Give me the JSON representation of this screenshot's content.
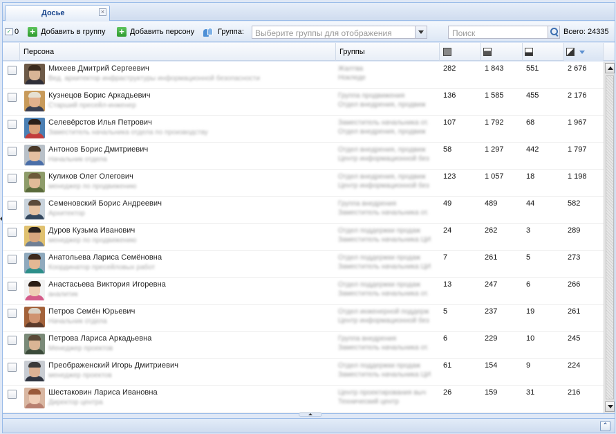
{
  "tab": {
    "title": "Досье",
    "close_glyph": "×"
  },
  "toolbar": {
    "selected_count": "0",
    "add_to_group": "Добавить в группу",
    "add_person": "Добавить персону",
    "group_label": "Группа:",
    "group_placeholder": "Выберите группы для отображения",
    "search_placeholder": "Поиск",
    "total": "Всего: 24335"
  },
  "columns": {
    "person": "Персона",
    "groups": "Группы",
    "metric_icons": [
      "metric-1-icon",
      "metric-2-icon",
      "metric-3-icon",
      "metric-4-icon"
    ],
    "sorted_by": "metric-4",
    "sort_direction": "desc"
  },
  "rows": [
    {
      "name": "Михеев Дмитрий Сергеевич",
      "role": "Вед. архитектор инфраструктуры информационной безопасности",
      "groups": [
        "Жалтва",
        "Нокледе"
      ],
      "m1": "282",
      "m2": "1 843",
      "m3": "551",
      "m4": "2 676"
    },
    {
      "name": "Кузнецов Борис Аркадьевич",
      "role": "Старший пресейл-инженер",
      "groups": [
        "Группа продвижения",
        "Отдел внедрения, продвиж"
      ],
      "m1": "136",
      "m2": "1 585",
      "m3": "455",
      "m4": "2 176"
    },
    {
      "name": "Селевёрстов Илья Петрович",
      "role": "Заместитель начальника отдела по производству",
      "groups": [
        "Заместитель начальника от.",
        "Отдел внедрения, продвиж"
      ],
      "m1": "107",
      "m2": "1 792",
      "m3": "68",
      "m4": "1 967"
    },
    {
      "name": "Антонов Борис Дмитриевич",
      "role": "Начальник отдела",
      "groups": [
        "Отдел внедрения, продвиж",
        "Центр информационной без"
      ],
      "m1": "58",
      "m2": "1 297",
      "m3": "442",
      "m4": "1 797"
    },
    {
      "name": "Куликов Олег Олегович",
      "role": "менеджер по продвижению",
      "groups": [
        "Отдел внедрения, продвиж",
        "Центр информационной без"
      ],
      "m1": "123",
      "m2": "1 057",
      "m3": "18",
      "m4": "1 198"
    },
    {
      "name": "Семеновский Борис Андреевич",
      "role": "Архитектор",
      "groups": [
        "Группа внедрения",
        "Заместитель начальника от."
      ],
      "m1": "49",
      "m2": "489",
      "m3": "44",
      "m4": "582"
    },
    {
      "name": "Дуров Кузьма Иванович",
      "role": "менеджер по продвижению",
      "groups": [
        "Отдел поддержки продаж",
        "Заместитель начальника ЦИ"
      ],
      "m1": "24",
      "m2": "262",
      "m3": "3",
      "m4": "289"
    },
    {
      "name": "Анатольева Лариса Семёновна",
      "role": "Координатор пресейловых работ",
      "groups": [
        "Отдел поддержки продаж",
        "Заместитель начальника ЦИ"
      ],
      "m1": "7",
      "m2": "261",
      "m3": "5",
      "m4": "273"
    },
    {
      "name": "Анастасьева Виктория Игоревна",
      "role": "аналитик",
      "groups": [
        "Отдел поддержки продаж",
        "Заместитель начальника от."
      ],
      "m1": "13",
      "m2": "247",
      "m3": "6",
      "m4": "266"
    },
    {
      "name": "Петров Семён Юрьевич",
      "role": "Начальник отдела",
      "groups": [
        "Отдел инженерной поддерж",
        "Центр информационной без"
      ],
      "m1": "5",
      "m2": "237",
      "m3": "19",
      "m4": "261"
    },
    {
      "name": "Петрова Лариса Аркадьевна",
      "role": "Менеджер проектов",
      "groups": [
        "Группа внедрения",
        "Заместитель начальника от."
      ],
      "m1": "6",
      "m2": "229",
      "m3": "10",
      "m4": "245"
    },
    {
      "name": "Преображенский Игорь Дмитриевич",
      "role": "менеджер проектов",
      "groups": [
        "Отдел поддержки продаж",
        "Заместитель начальника ЦИ"
      ],
      "m1": "61",
      "m2": "154",
      "m3": "9",
      "m4": "224"
    },
    {
      "name": "Шестаковин Лариса Ивановна",
      "role": "Директор центра",
      "groups": [
        "Центр проектирования выч",
        "Технический центр"
      ],
      "m1": "26",
      "m2": "159",
      "m3": "31",
      "m4": "216"
    }
  ],
  "avatar_palette": [
    {
      "bg": "#6d5a47",
      "hair": "#3a2a1c",
      "face": "#d8b596",
      "shoulders": "#2f2f38"
    },
    {
      "bg": "#c89a5a",
      "hair": "#e6e0d2",
      "face": "#e2b08c",
      "shoulders": "#3a3f52"
    },
    {
      "bg": "#4b7fb3",
      "hair": "#2b1f18",
      "face": "#d9a17a",
      "shoulders": "#c23d3d"
    },
    {
      "bg": "#b8c0c8",
      "hair": "#4a3a2a",
      "face": "#e4bfa1",
      "shoulders": "#4a6ea8"
    },
    {
      "bg": "#8e9c6a",
      "hair": "#6d5a3a",
      "face": "#e0bb98",
      "shoulders": "#596a3a"
    },
    {
      "bg": "#c9d3dc",
      "hair": "#5a4a3a",
      "face": "#e6c3a3",
      "shoulders": "#33475e"
    },
    {
      "bg": "#e0c170",
      "hair": "#2a2220",
      "face": "#d7a57f",
      "shoulders": "#6f7f95"
    },
    {
      "bg": "#8fa9bd",
      "hair": "#3d2a1e",
      "face": "#e3b894",
      "shoulders": "#2d8f8a"
    },
    {
      "bg": "#f2f2f2",
      "hair": "#2b1d15",
      "face": "#efcfb5",
      "shoulders": "#d55c8a"
    },
    {
      "bg": "#a3623a",
      "hair": "#d9d2c6",
      "face": "#cf9370",
      "shoulders": "#5b3a2a"
    },
    {
      "bg": "#7a8a78",
      "hair": "#5a4a38",
      "face": "#dab595",
      "shoulders": "#3b4b3a"
    },
    {
      "bg": "#c8ccd2",
      "hair": "#3a3a3a",
      "face": "#dcb294",
      "shoulders": "#2f3440"
    },
    {
      "bg": "#d9b7a2",
      "hair": "#9a5a3a",
      "face": "#f0cfb8",
      "shoulders": "#b88070"
    }
  ]
}
